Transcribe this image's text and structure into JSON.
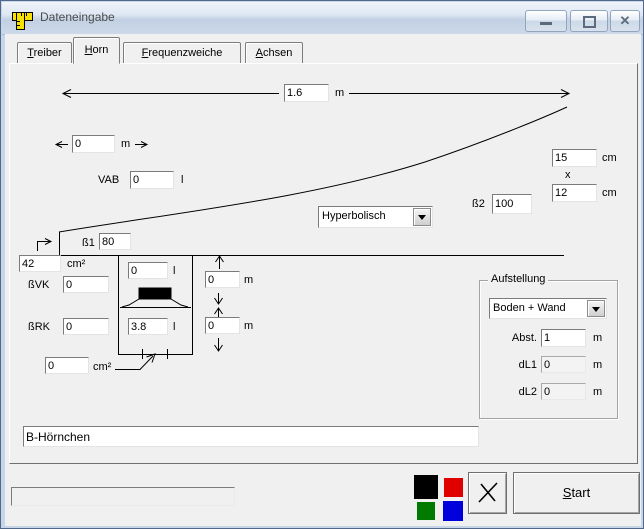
{
  "window": {
    "title": "Dateneingabe"
  },
  "tabs": [
    {
      "hotkey": "T",
      "rest": "reiber"
    },
    {
      "hotkey": "H",
      "rest": "orn"
    },
    {
      "hotkey": "F",
      "rest": "requenzweiche"
    },
    {
      "hotkey": "A",
      "rest": "chsen"
    }
  ],
  "horn": {
    "length": {
      "value": "1.6",
      "unit": "m"
    },
    "offset": {
      "value": "0",
      "unit": "m"
    },
    "vab": {
      "label": "VAB",
      "value": "0",
      "unit": "l"
    },
    "beta1": {
      "label": "ß1",
      "value": "80"
    },
    "beta2": {
      "label": "ß2",
      "value": "100"
    },
    "contour": {
      "value": "Hyperbolisch"
    },
    "mouth_width": {
      "value": "15",
      "unit": "cm"
    },
    "mouth_times": "x",
    "mouth_height": {
      "value": "12",
      "unit": "cm"
    },
    "throat_area": {
      "value": "42",
      "unit": "cm²"
    },
    "bvk": {
      "label": "ßVK",
      "value": "0"
    },
    "brk": {
      "label": "ßRK",
      "value": "0"
    },
    "front_volume": {
      "value": "0",
      "unit": "l"
    },
    "rear_volume": {
      "value": "3.8",
      "unit": "l"
    },
    "front_distance": {
      "value": "0",
      "unit": "m"
    },
    "rear_distance": {
      "value": "0",
      "unit": "m"
    },
    "port_area": {
      "value": "0",
      "unit": "cm²"
    }
  },
  "aufstellung": {
    "title": "Aufstellung",
    "placement": "Boden + Wand",
    "abst": {
      "label": "Abst.",
      "value": "1",
      "unit": "m"
    },
    "dl1": {
      "label": "dL1",
      "value": "0",
      "unit": "m"
    },
    "dl2": {
      "label": "dL2",
      "value": "0",
      "unit": "m"
    }
  },
  "project_name": "B-Hörnchen",
  "footer": {
    "start": {
      "hotkey": "S",
      "rest": "tart"
    },
    "legend_colors": [
      "#000000",
      "#e00000",
      "#007a00",
      "#0000dd"
    ]
  }
}
